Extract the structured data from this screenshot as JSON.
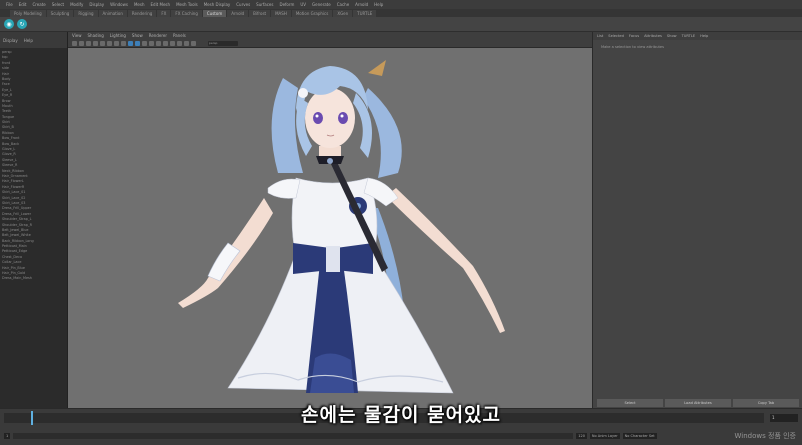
{
  "menubar": [
    "File",
    "Edit",
    "Create",
    "Select",
    "Modify",
    "Display",
    "Windows",
    "Mesh",
    "Edit Mesh",
    "Mesh Tools",
    "Mesh Display",
    "Curves",
    "Surfaces",
    "Deform",
    "UV",
    "Generate",
    "Cache",
    "Arnold",
    "Help"
  ],
  "shelf_tabs": [
    {
      "label": "Poly Modeling",
      "active": false
    },
    {
      "label": "Sculpting",
      "active": false
    },
    {
      "label": "Rigging",
      "active": false
    },
    {
      "label": "Animation",
      "active": false
    },
    {
      "label": "Rendering",
      "active": false
    },
    {
      "label": "FX",
      "active": false
    },
    {
      "label": "FX Caching",
      "active": false
    },
    {
      "label": "Custom",
      "active": true
    },
    {
      "label": "Arnold",
      "active": false
    },
    {
      "label": "Bifrost",
      "active": false
    },
    {
      "label": "MASH",
      "active": false
    },
    {
      "label": "Motion Graphics",
      "active": false
    },
    {
      "label": "XGen",
      "active": false
    },
    {
      "label": "TURTLE",
      "active": false
    }
  ],
  "outliner": {
    "menu": [
      "Display",
      "Help"
    ],
    "rows": [
      "persp",
      "top",
      "front",
      "side",
      "Hair",
      "Body",
      "Face",
      "Eye_L",
      "Eye_R",
      "Brow",
      "Mouth",
      "Teeth",
      "Tongue",
      "Skirt",
      "Skirt_B",
      "Ribbon",
      "Bow_Front",
      "Bow_Back",
      "Glove_L",
      "Glove_R",
      "Sleeve_L",
      "Sleeve_R",
      "Neck_Ribbon",
      "Hair_Ornament",
      "Hair_FlowerL",
      "Hair_FlowerR",
      "Skirt_Lace_01",
      "Skirt_Lace_02",
      "Skirt_Lace_03",
      "Dress_Frill_Upper",
      "Dress_Frill_Lower",
      "Shoulder_Strap_L",
      "Shoulder_Strap_R",
      "Belt_Jewel_Blue",
      "Belt_Jewel_White",
      "Back_Ribbon_Long",
      "Petticoat_Main",
      "Petticoat_Edge",
      "Chest_Deco",
      "Collar_Lace",
      "Hair_Pin_Blue",
      "Hair_Pin_Gold",
      "Dress_Main_Mesh"
    ]
  },
  "viewport": {
    "menu": [
      "View",
      "Shading",
      "Lighting",
      "Show",
      "Renderer",
      "Panels"
    ],
    "camera_field": "persp",
    "subtitle": "손에는 물감이 묻어있고"
  },
  "attribute_editor": {
    "tabs": [
      "List",
      "Selected",
      "Focus",
      "Attributes",
      "Show",
      "TURTLE",
      "Help"
    ],
    "message": "Make a selection to view attributes",
    "buttons": [
      "Select",
      "Load Attributes",
      "Copy Tab"
    ]
  },
  "timeslider": {
    "current_frame": "1"
  },
  "rangebar": {
    "start": "1",
    "end": "120",
    "anim_layer": "No Anim Layer",
    "char_set": "No Character Set"
  },
  "watermark": "Windows 정품 인증",
  "colors": {
    "viewport_bg": "#707070",
    "accent": "#3d7fb8",
    "hair": "#a9c4e6",
    "dress": "#eef0f5",
    "navy": "#2b3a78"
  }
}
